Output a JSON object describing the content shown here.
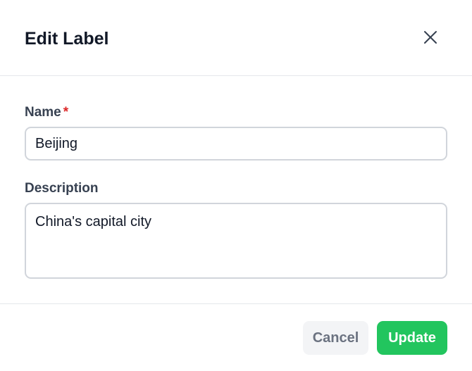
{
  "dialog": {
    "title": "Edit Label",
    "close_icon": "close-icon"
  },
  "form": {
    "name": {
      "label": "Name",
      "required_marker": "*",
      "value": "Beijing"
    },
    "description": {
      "label": "Description",
      "value": "China's capital city"
    }
  },
  "actions": {
    "cancel_label": "Cancel",
    "update_label": "Update"
  },
  "colors": {
    "primary": "#22c55e",
    "required": "#dc2626",
    "cancel_bg": "#f3f4f6"
  }
}
